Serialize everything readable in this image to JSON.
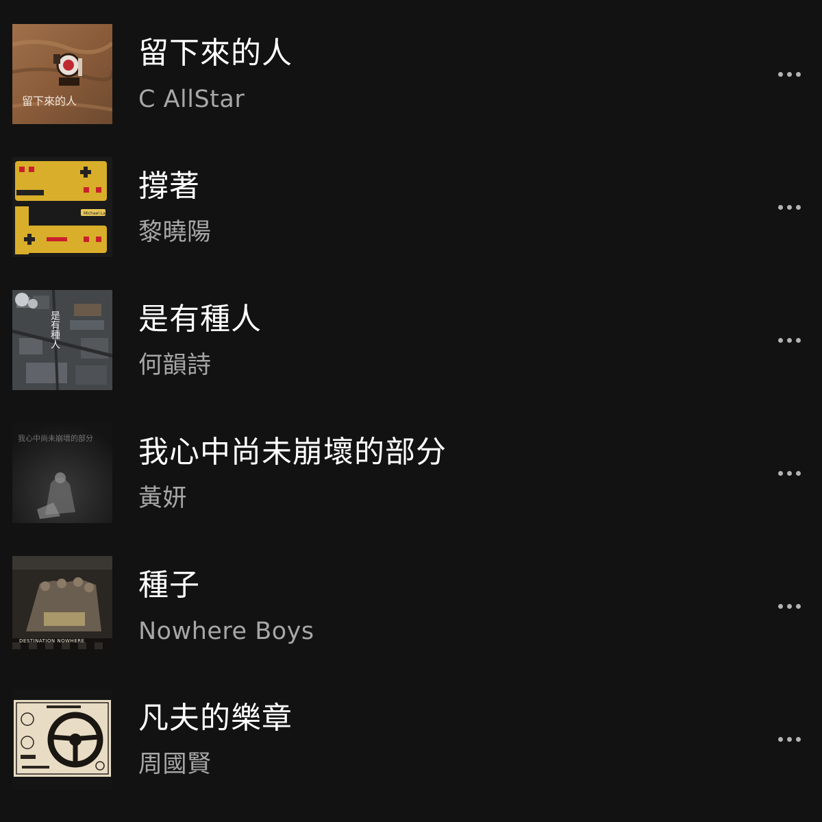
{
  "colors": {
    "background": "#121212",
    "title_text": "#ffffff",
    "artist_text": "#a7a7a7",
    "more_icon": "#b3b3b3"
  },
  "tracks": [
    {
      "title": "留下來的人",
      "artist": "C AllStar",
      "cover_text": "留下來的人",
      "more_icon": "more-horizontal-icon"
    },
    {
      "title": "撐著",
      "artist": "黎曉陽",
      "cover_text": "Michael Lai",
      "more_icon": "more-horizontal-icon"
    },
    {
      "title": "是有種人",
      "artist": "何韻詩",
      "cover_text": "是有種人",
      "more_icon": "more-horizontal-icon"
    },
    {
      "title": "我心中尚未崩壞的部分",
      "artist": "黃妍",
      "cover_text": "我心中尚未崩壞的部分",
      "more_icon": "more-horizontal-icon"
    },
    {
      "title": "種子",
      "artist": "Nowhere Boys",
      "cover_text": "DESTINATION NOWHERE",
      "more_icon": "more-horizontal-icon"
    },
    {
      "title": "凡夫的樂章",
      "artist": "周國賢",
      "cover_text": "",
      "more_icon": "more-horizontal-icon"
    }
  ]
}
